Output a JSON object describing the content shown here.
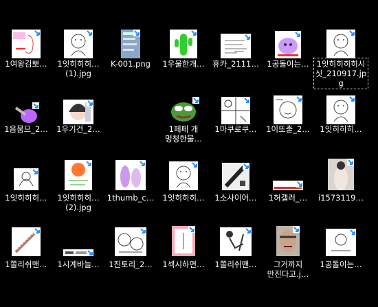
{
  "accent_color": "#1e90ff",
  "files": [
    {
      "label": "1여왕김뽀…",
      "thumb": "pink-doodle"
    },
    {
      "label": "1잇히히히…\n(1).jpg",
      "thumb": "sketch"
    },
    {
      "label": "K-001.png",
      "thumb": "blue-screenshot"
    },
    {
      "label": "1우울한개…",
      "thumb": "green-cactus"
    },
    {
      "label": "휴카_2111…",
      "thumb": "text-note"
    },
    {
      "label": "1공돌이는…",
      "thumb": "purple-blob"
    },
    {
      "label": "1잇히히히히시싯_210917.jpg",
      "thumb": "sketch",
      "selected": true
    },
    {
      "label": "1음뭄므_2…",
      "thumb": "purple-hand"
    },
    {
      "label": "1우기건_2…",
      "thumb": "anime-girl"
    },
    {
      "label": "",
      "thumb": "none"
    },
    {
      "label": "1페페 개\n멍청한물…",
      "thumb": "pepe"
    },
    {
      "label": "1마쿠로쿠…",
      "thumb": "comic"
    },
    {
      "label": "1이또출_2…",
      "thumb": "doodle-face"
    },
    {
      "label": "1잇히히히…",
      "thumb": "sketch"
    },
    {
      "label": "1잇히히히…",
      "thumb": "sketch-small"
    },
    {
      "label": "1잇히히히…\n(2).jpg",
      "thumb": "orange-face"
    },
    {
      "label": "1thumb_c…",
      "thumb": "purple-figures"
    },
    {
      "label": "1잇히히히…",
      "thumb": "sketch"
    },
    {
      "label": "1소사이어…",
      "thumb": "dark-photo"
    },
    {
      "label": "1허갤러_…",
      "thumb": "wide-strip"
    },
    {
      "label": "i1573119…",
      "thumb": "photo-person"
    },
    {
      "label": "1쫄리쉬맨…",
      "thumb": "stick"
    },
    {
      "label": "1시계바늘…",
      "thumb": "tiny-strip"
    },
    {
      "label": "1진토리_2…",
      "thumb": "faces-sketch"
    },
    {
      "label": "1섹시하면…",
      "thumb": "pink-frame"
    },
    {
      "label": "1쫄리쉬맨…",
      "thumb": "fighting-sketch"
    },
    {
      "label": "그거까지\n만진다고.j…",
      "thumb": "man-face"
    },
    {
      "label": "1공돌이는…",
      "thumb": "text-small"
    }
  ]
}
